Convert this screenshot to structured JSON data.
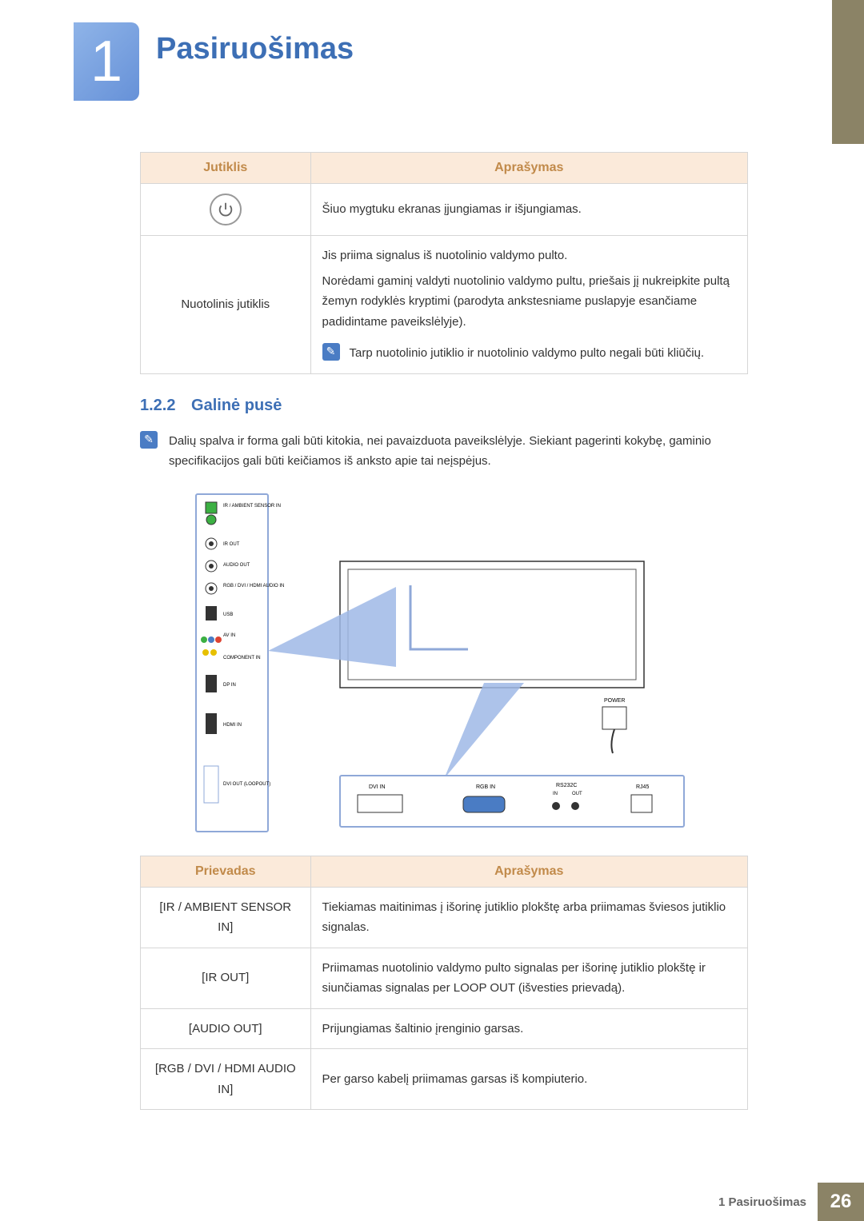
{
  "chapter": {
    "number": "1",
    "title": "Pasiruošimas"
  },
  "table1": {
    "headers": {
      "left": "Jutiklis",
      "right": "Aprašymas"
    },
    "row_power": {
      "desc": "Šiuo mygtuku ekranas įjungiamas ir išjungiamas."
    },
    "row_remote": {
      "label": "Nuotolinis jutiklis",
      "desc1": "Jis priima signalus iš nuotolinio valdymo pulto.",
      "desc2": "Norėdami gaminį valdyti nuotolinio valdymo pultu, priešais jį nukreipkite pultą žemyn rodyklės kryptimi (parodyta ankstesniame puslapyje esančiame padidintame paveikslėlyje).",
      "note": "Tarp nuotolinio jutiklio ir nuotolinio valdymo pulto negali būti kliūčių."
    }
  },
  "section": {
    "number": "1.2.2",
    "title": "Galinė pusė",
    "note": "Dalių spalva ir forma gali būti kitokia, nei pavaizduota paveikslėlyje. Siekiant pagerinti kokybę, gaminio specifikacijos gali būti keičiamos iš anksto apie tai neįspėjus."
  },
  "diagram_labels": {
    "ir_sensor": "IR / AMBIENT SENSOR IN",
    "ir_out": "IR OUT",
    "audio_out": "AUDIO OUT",
    "audio_in": "RGB / DVI / HDMI AUDIO IN",
    "usb": "USB",
    "av_in": "AV IN",
    "component": "COMPONENT IN",
    "dp_in": "DP IN",
    "hdmi_in": "HDMI IN",
    "dvi_out": "DVI OUT (LOOPOUT)",
    "power": "POWER",
    "dvi_in": "DVI IN",
    "rgb_in": "RGB IN",
    "rs232c": "RS232C",
    "in": "IN",
    "out": "OUT",
    "rj45": "RJ45"
  },
  "table2": {
    "headers": {
      "left": "Prievadas",
      "right": "Aprašymas"
    },
    "rows": [
      {
        "port": "[IR / AMBIENT SENSOR IN]",
        "desc": "Tiekiamas maitinimas į išorinę jutiklio plokštę arba priimamas šviesos jutiklio signalas."
      },
      {
        "port": "[IR OUT]",
        "desc": "Priimamas nuotolinio valdymo pulto signalas per išorinę jutiklio plokštę ir siunčiamas signalas per LOOP OUT (išvesties prievadą)."
      },
      {
        "port": "[AUDIO OUT]",
        "desc": "Prijungiamas šaltinio įrenginio garsas."
      },
      {
        "port": "[RGB / DVI / HDMI AUDIO IN]",
        "desc": "Per garso kabelį priimamas garsas iš kompiuterio."
      }
    ]
  },
  "footer": {
    "text": "1 Pasiruošimas",
    "page": "26"
  }
}
